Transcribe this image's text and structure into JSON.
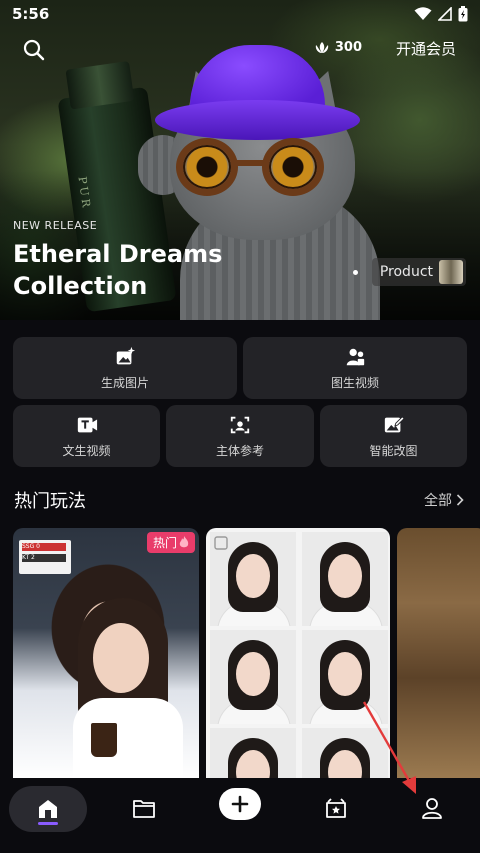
{
  "status_bar": {
    "time": "5:56"
  },
  "header": {
    "credits": "300",
    "vip_label": "开通会员"
  },
  "hero": {
    "label": "NEW RELEASE",
    "title_line1": "Etheral Dreams",
    "title_line2": "Collection",
    "product_tag": "Product",
    "bottle_text": "PUR"
  },
  "features": [
    {
      "label": "生成图片",
      "icon": "image-sparkle-icon"
    },
    {
      "label": "图生视频",
      "icon": "video-person-icon"
    },
    {
      "label": "文生视频",
      "icon": "text-video-icon"
    },
    {
      "label": "主体参考",
      "icon": "face-scan-icon"
    },
    {
      "label": "智能改图",
      "icon": "image-edit-icon"
    }
  ],
  "hot_section": {
    "title": "热门玩法",
    "see_all": "全部"
  },
  "hot_cards": [
    {
      "badge": "热门"
    },
    {},
    {}
  ],
  "scoreboard": {
    "row1": "SSG 0",
    "row2": "KT 2"
  },
  "bottom_nav": [
    {
      "icon": "home-icon"
    },
    {
      "icon": "folder-icon"
    },
    {
      "icon": "plus-icon"
    },
    {
      "icon": "star-box-icon"
    },
    {
      "icon": "profile-icon"
    }
  ],
  "colors": {
    "accent": "#8a5cff",
    "card_bg": "#232327",
    "hot_badge": "#e93c6a",
    "bg": "#0b0b0f"
  }
}
